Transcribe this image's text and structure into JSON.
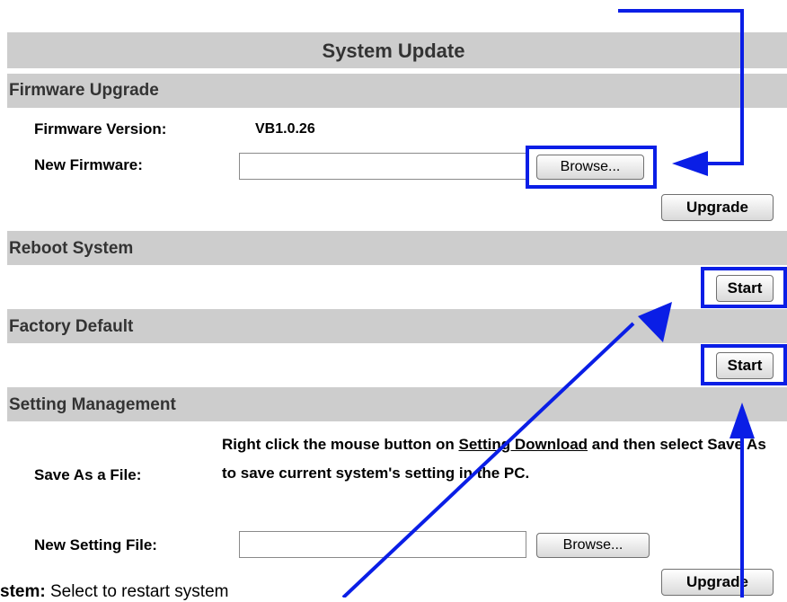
{
  "title": "System Update",
  "firmware": {
    "section_label": "Firmware Upgrade",
    "version_label": "Firmware Version:",
    "version_value": "VB1.0.26",
    "new_label": "New Firmware:",
    "new_value": "",
    "browse_label": "Browse...",
    "upgrade_label": "Upgrade"
  },
  "reboot": {
    "section_label": "Reboot System",
    "start_label": "Start"
  },
  "factory": {
    "section_label": "Factory Default",
    "start_label": "Start"
  },
  "setting": {
    "section_label": "Setting Management",
    "save_label": "Save As a File:",
    "desc_before": "Right click the mouse button on ",
    "desc_link": "Setting Download",
    "desc_after": " and then select Save As to save current system's setting in the PC.",
    "new_label": "New Setting File:",
    "new_value": "",
    "browse_label": "Browse...",
    "upgrade_label": "Upgrade"
  },
  "footer": {
    "term": "stem:",
    "text": " Select to restart system"
  },
  "colors": {
    "annotation": "#0a1ee6",
    "section_bar": "#cdcdcd"
  }
}
